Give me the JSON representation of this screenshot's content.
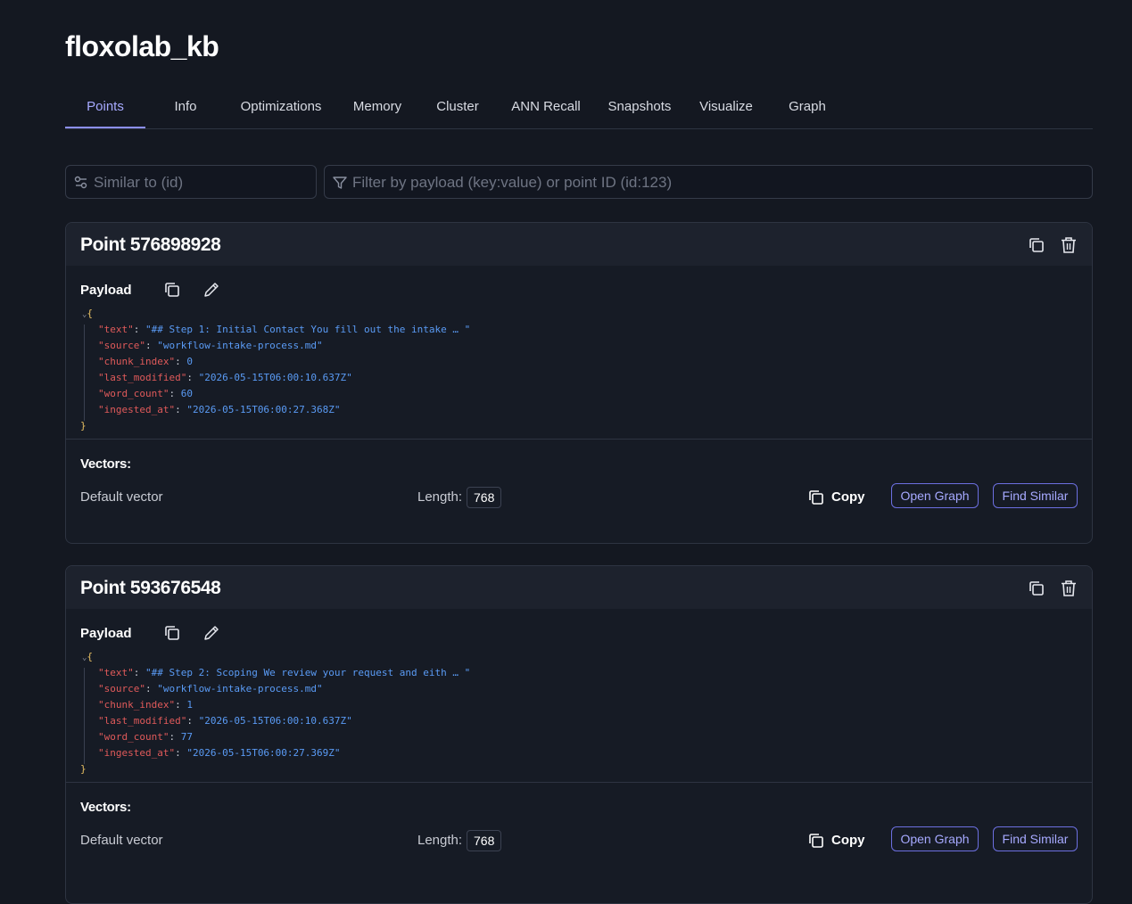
{
  "app": {
    "title": "floxolab_kb"
  },
  "tabs": [
    {
      "label": "Points"
    },
    {
      "label": "Info"
    },
    {
      "label": "Optimizations"
    },
    {
      "label": "Memory"
    },
    {
      "label": "Cluster"
    },
    {
      "label": "ANN Recall"
    },
    {
      "label": "Snapshots"
    },
    {
      "label": "Visualize"
    },
    {
      "label": "Graph"
    }
  ],
  "active_tab": "Points",
  "search": {
    "similar_placeholder": "Similar to (id)",
    "filter_placeholder": "Filter by payload (key:value) or point ID (id:123)"
  },
  "labels": {
    "payload": "Payload",
    "vectors": "Vectors:",
    "default_vector": "Default vector",
    "length": "Length:",
    "copy": "Copy",
    "open_graph": "Open Graph",
    "find_similar": "Find Similar"
  },
  "colors": {
    "accent": "#8c8ff5",
    "background": "#141821",
    "json_key": "#e05a5a",
    "json_value": "#5a9bf5",
    "json_brace": "#e8c062"
  },
  "points": [
    {
      "title": "Point 576898928",
      "payload": {
        "text": "\"## Step 1: Initial Contact You fill out the intake … \"",
        "source": "\"workflow-intake-process.md\"",
        "chunk_index": "0",
        "last_modified": "\"2026-05-15T06:00:10.637Z\"",
        "word_count": "60",
        "ingested_at": "\"2026-05-15T06:00:27.368Z\""
      },
      "vector_length": "768"
    },
    {
      "title": "Point 593676548",
      "payload": {
        "text": "\"## Step 2: Scoping We review your request and eith … \"",
        "source": "\"workflow-intake-process.md\"",
        "chunk_index": "1",
        "last_modified": "\"2026-05-15T06:00:10.637Z\"",
        "word_count": "77",
        "ingested_at": "\"2026-05-15T06:00:27.369Z\""
      },
      "vector_length": "768"
    }
  ]
}
